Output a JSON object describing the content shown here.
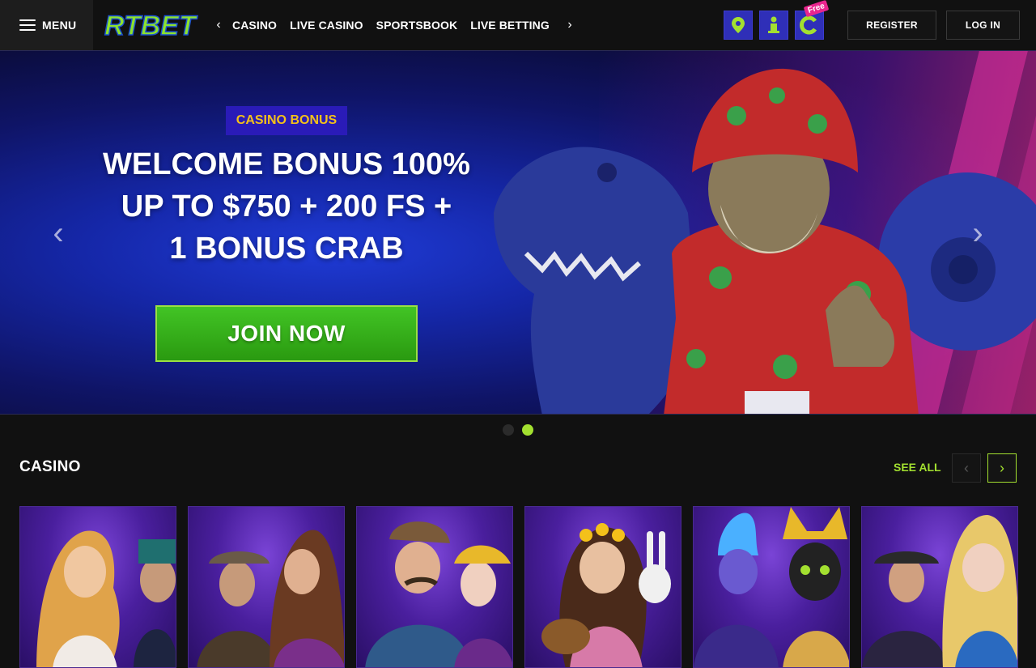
{
  "header": {
    "menu_label": "MENU",
    "logo_text": "RTBET",
    "nav": [
      "CASINO",
      "LIVE CASINO",
      "SPORTSBOOK",
      "LIVE BETTING"
    ],
    "quick_icons": [
      {
        "name": "location-icon"
      },
      {
        "name": "person-icon"
      },
      {
        "name": "coin-icon",
        "tag": "Free"
      }
    ],
    "register_label": "REGISTER",
    "login_label": "LOG IN"
  },
  "hero": {
    "badge": "CASINO BONUS",
    "headline": [
      "WELCOME BONUS 100%",
      "UP TO $750 + 200 FS +",
      "1 BONUS CRAB"
    ],
    "cta_label": "JOIN NOW",
    "slides": 2,
    "active_slide": 2
  },
  "casino": {
    "title": "CASINO",
    "see_all_label": "SEE ALL"
  },
  "colors": {
    "accent": "#a3e030",
    "badge_text": "#f4c11a",
    "badge_bg": "#2a1bb8",
    "cta_green": "#2a9a10",
    "page_bg": "#111111"
  }
}
